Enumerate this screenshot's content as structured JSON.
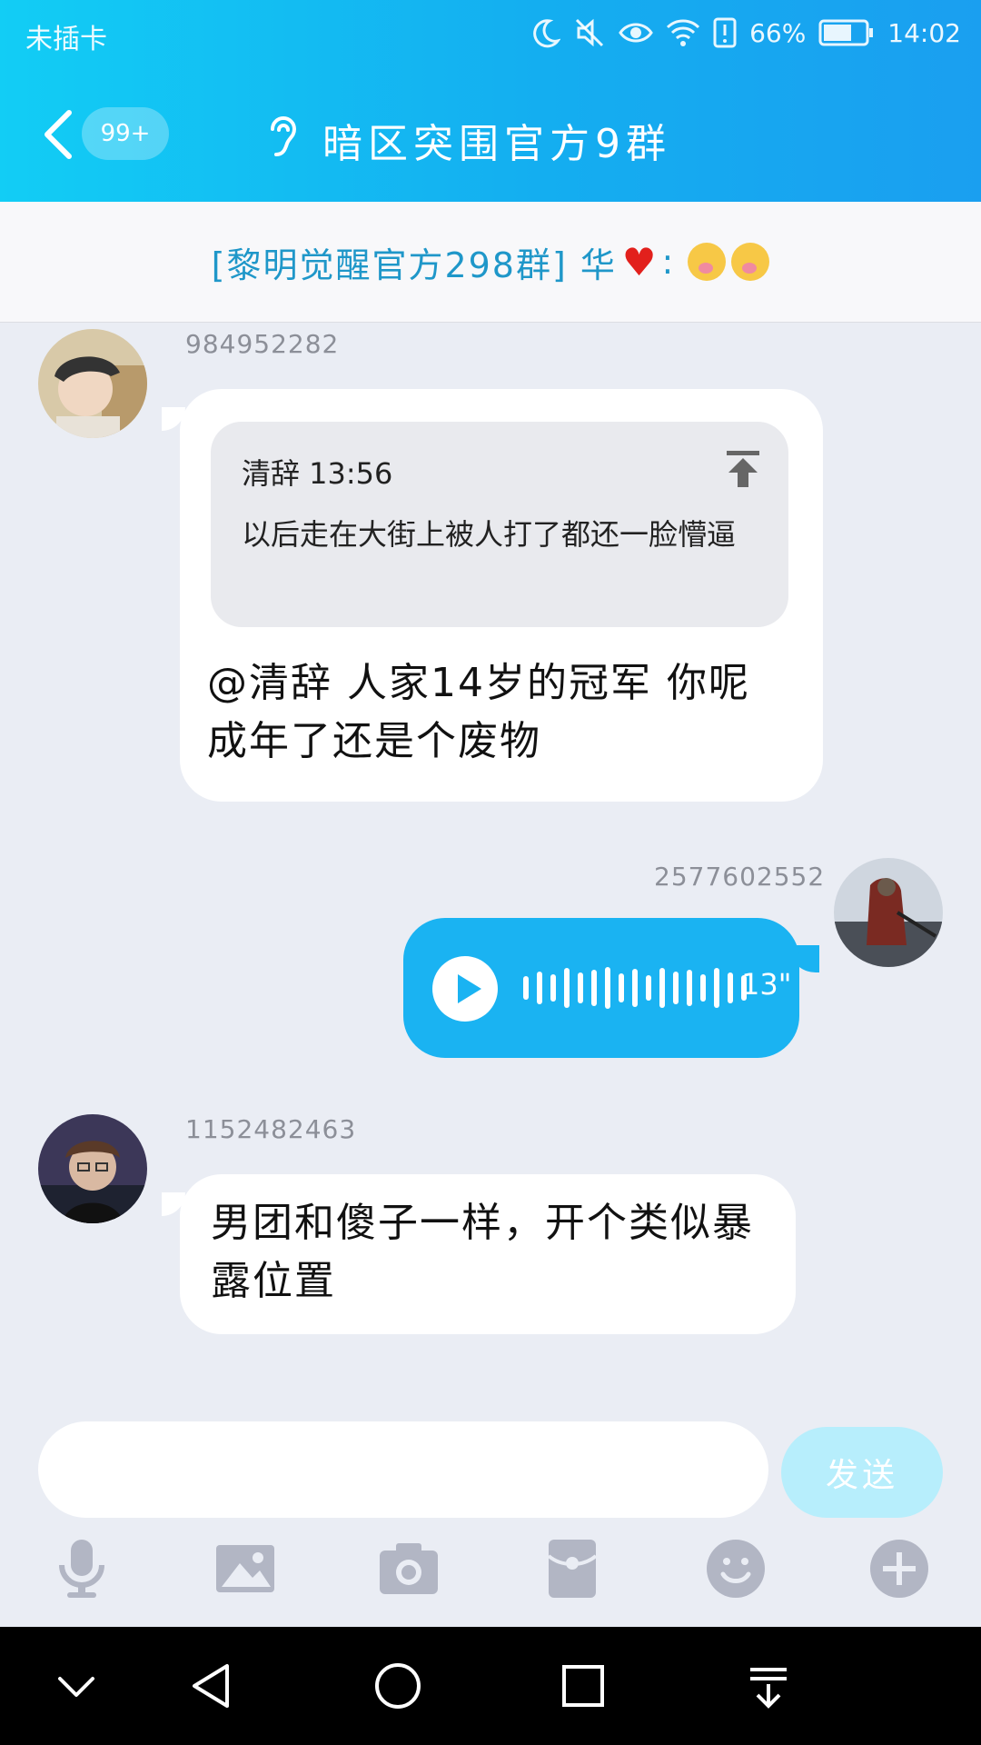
{
  "status_bar": {
    "carrier": "未插卡",
    "battery": "66%",
    "time": "14:02"
  },
  "header": {
    "unread_badge": "99+",
    "title": "暗区突围官方9群"
  },
  "pinned_banner": {
    "text": "[黎明觉醒官方298群] 华",
    "separator": ":"
  },
  "messages": [
    {
      "sender": "984952282",
      "quote": {
        "author_time": "清辞 13:56",
        "text": "以后走在大街上被人打了都还一脸懵逼"
      },
      "text": "@清辞 人家14岁的冠军 你呢成年了还是个废物"
    },
    {
      "sender": "2577602552",
      "voice_duration": "13\""
    },
    {
      "sender": "1152482463",
      "text": "男团和傻子一样，开个类似暴露位置"
    }
  ],
  "input": {
    "placeholder": "",
    "send_label": "发送"
  },
  "colors": {
    "header_start": "#12cdf5",
    "header_end": "#1a9ff0",
    "voice_bubble": "#1ab3f2",
    "banner_text": "#1f97c9",
    "send_disabled": "#b7eefc"
  },
  "icons": {
    "toolbar": [
      "microphone-icon",
      "image-icon",
      "camera-icon",
      "red-packet-icon",
      "emoji-icon",
      "plus-icon"
    ],
    "nav": [
      "chevron-down-icon",
      "back-triangle-icon",
      "home-circle-icon",
      "recents-square-icon",
      "notification-pull-icon"
    ]
  }
}
